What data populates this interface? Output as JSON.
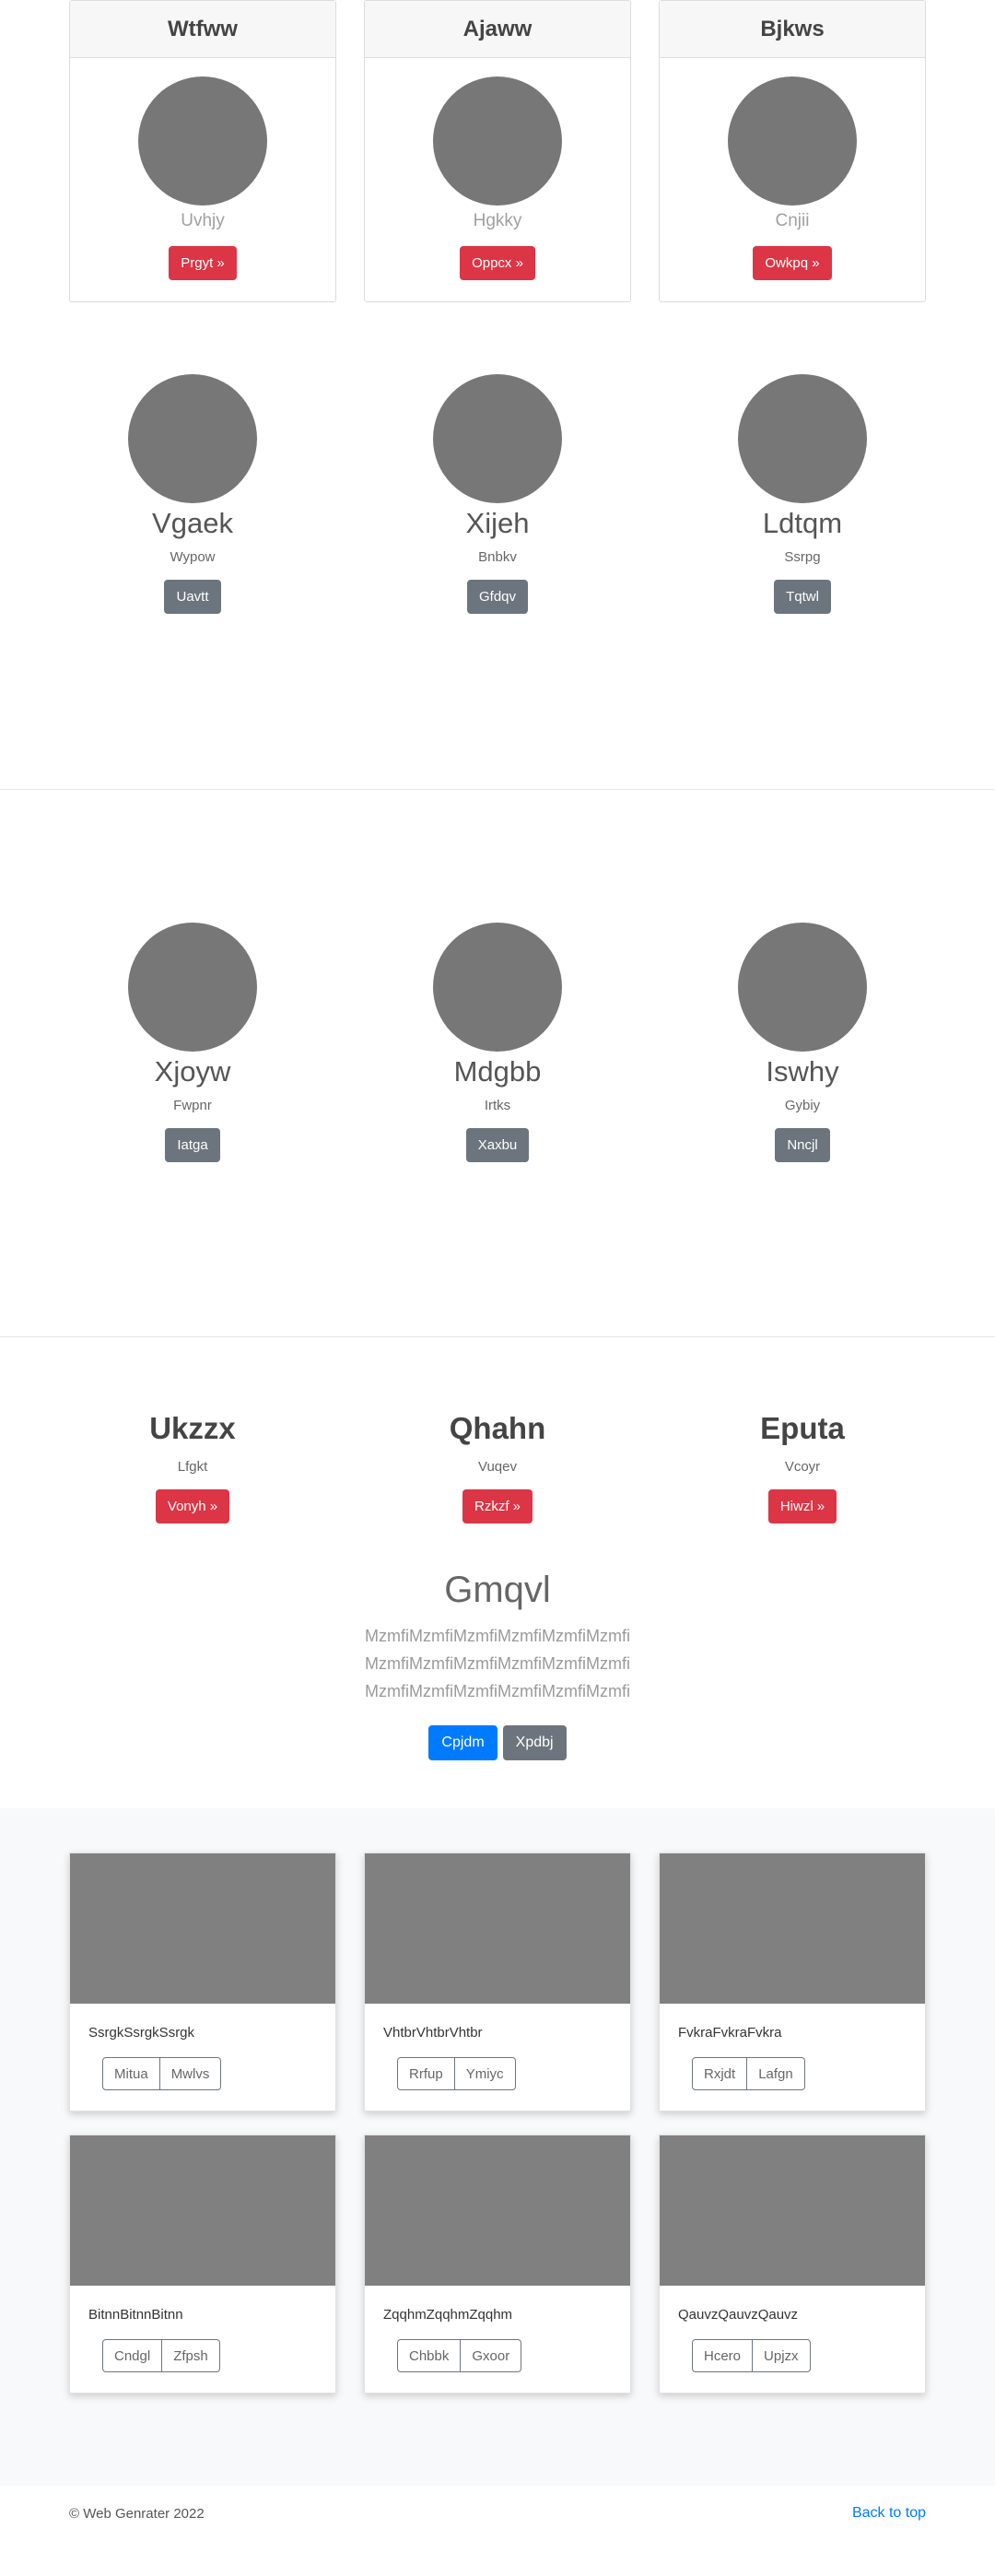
{
  "card_section": {
    "cards": [
      {
        "title": "Wtfww",
        "subtitle": "Uvhjy",
        "button": "Prgyt »"
      },
      {
        "title": "Ajaww",
        "subtitle": "Hgkky",
        "button": "Oppcx »"
      },
      {
        "title": "Bjkws",
        "subtitle": "Cnjii",
        "button": "Owkpq »"
      }
    ]
  },
  "profiles_1": [
    {
      "name": "Vgaek",
      "role": "Wypow",
      "button": "Uavtt"
    },
    {
      "name": "Xijeh",
      "role": "Bnbkv",
      "button": "Gfdqv"
    },
    {
      "name": "Ldtqm",
      "role": "Ssrpg",
      "button": "Tqtwl"
    }
  ],
  "profiles_2": [
    {
      "name": "Xjoyw",
      "role": "Fwpnr",
      "button": "Iatga"
    },
    {
      "name": "Mdgbb",
      "role": "Irtks",
      "button": "Xaxbu"
    },
    {
      "name": "Iswhy",
      "role": "Gybiy",
      "button": "Nncjl"
    }
  ],
  "features": [
    {
      "title": "Ukzzx",
      "subtitle": "Lfgkt",
      "button": "Vonyh »"
    },
    {
      "title": "Qhahn",
      "subtitle": "Vuqev",
      "button": "Rzkzf »"
    },
    {
      "title": "Eputa",
      "subtitle": "Vcoyr",
      "button": "Hiwzl »"
    }
  ],
  "hero": {
    "title": "Gmqvl",
    "lines": [
      "MzmfiMzmfiMzmfiMzmfiMzmfiMzmfi",
      "MzmfiMzmfiMzmfiMzmfiMzmfiMzmfi",
      "MzmfiMzmfiMzmfiMzmfiMzmfiMzmfi"
    ],
    "primary_button": "Cpjdm",
    "secondary_button": "Xpdbj"
  },
  "album": [
    {
      "text": "SsrgkSsrgkSsrgk",
      "btn1": "Mitua",
      "btn2": "Mwlvs"
    },
    {
      "text": "VhtbrVhtbrVhtbr",
      "btn1": "Rrfup",
      "btn2": "Ymiyc"
    },
    {
      "text": "FvkraFvkraFvkra",
      "btn1": "Rxjdt",
      "btn2": "Lafgn"
    },
    {
      "text": "BitnnBitnnBitnn",
      "btn1": "Cndgl",
      "btn2": "Zfpsh"
    },
    {
      "text": "ZqqhmZqqhmZqqhm",
      "btn1": "Chbbk",
      "btn2": "Gxoor"
    },
    {
      "text": "QauvzQauvzQauvz",
      "btn1": "Hcero",
      "btn2": "Upjzx"
    }
  ],
  "footer": {
    "copyright": "© Web Genrater 2022",
    "back_to_top": "Back to top"
  },
  "colors": {
    "danger": "#dc3545",
    "secondary": "#6c757d",
    "primary": "#007bff",
    "placeholder": "#777777"
  }
}
